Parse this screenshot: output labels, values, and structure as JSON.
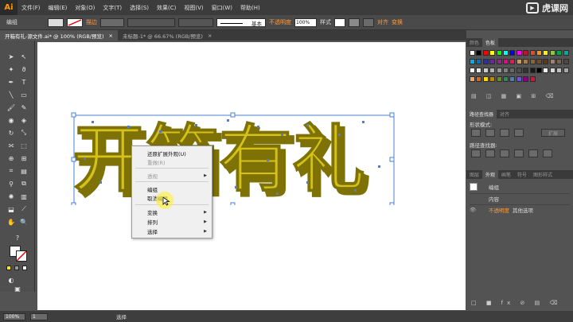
{
  "menubar": {
    "logo": "Ai",
    "items": [
      "文件(F)",
      "编辑(E)",
      "对象(O)",
      "文字(T)",
      "选择(S)",
      "效果(C)",
      "视图(V)",
      "窗口(W)",
      "帮助(H)"
    ],
    "watermark": "虎课网"
  },
  "controlbar": {
    "selection_label": "编组",
    "stroke_label": "描边",
    "stroke_style": "基本",
    "opacity_label": "不透明度",
    "opacity_value": "100%",
    "style_label": "样式",
    "align_label": "对齐",
    "transform_label": "变换"
  },
  "tabs": [
    {
      "label": "开箱有礼-源文件.ai* @ 100% (RGB/预览)",
      "close": "×"
    },
    {
      "label": "未标题-1* @ 66.67% (RGB/预览)",
      "close": "×"
    }
  ],
  "artwork": {
    "text": "开箱有礼",
    "fill_color": "#d4c21a",
    "shadow_color": "#7e7206",
    "selection_color": "#4a7fd4"
  },
  "context_menu": {
    "items": [
      {
        "label": "还原扩展外观(U)",
        "disabled": false
      },
      {
        "label": "重做(R)",
        "disabled": true
      },
      {
        "label": "透视",
        "disabled": true,
        "submenu": true
      },
      {
        "label": "编组",
        "disabled": false
      },
      {
        "label": "取消编组",
        "disabled": false
      },
      {
        "label": "变换",
        "disabled": false,
        "submenu": true
      },
      {
        "label": "排列",
        "disabled": false,
        "submenu": true
      },
      {
        "label": "选择",
        "disabled": false,
        "submenu": true
      }
    ]
  },
  "statusbar": {
    "zoom": "100%",
    "page": "1",
    "tool": "选择"
  },
  "panels": {
    "swatch_tabs": [
      "颜色",
      "色板"
    ],
    "pathfinder_tabs": [
      "路径查找器",
      "对齐"
    ],
    "shape_modes_label": "形状模式:",
    "pathfinder_label": "路径查找器:",
    "expand_label": "扩展",
    "appearance_tabs": [
      "图层",
      "外观",
      "画笔",
      "符号",
      "图形样式"
    ],
    "appearance_title": "编组",
    "appearance_content": "内容",
    "appearance_opacity": "不透明度",
    "appearance_opacity_value": "其他选项"
  },
  "swatch_colors": [
    "#ffffff",
    "#000000",
    "#ff0000",
    "#ffff00",
    "#00ff00",
    "#00ffff",
    "#0000ff",
    "#ff00ff",
    "#c8102e",
    "#e34c26",
    "#f7941d",
    "#fff200",
    "#8dc63f",
    "#00a651",
    "#00a99d",
    "#00aeef",
    "#0072bc",
    "#2e3192",
    "#662d91",
    "#92278f",
    "#ec008c",
    "#ed145b",
    "#c69c6d",
    "#a67c52",
    "#8c6239",
    "#754c24",
    "#603913",
    "#998675",
    "#736357",
    "#534741",
    "#ffffff",
    "#e6e6e6",
    "#cccccc",
    "#b3b3b3",
    "#999999",
    "#808080",
    "#666666",
    "#4d4d4d",
    "#333333",
    "#1a1a1a",
    "#000000",
    "#f2f2f2",
    "#d9d9d9",
    "#bfbfbf",
    "#a6a6a6",
    "#f4a460",
    "#d2691e",
    "#ffd700",
    "#b8860b",
    "#6b8e23",
    "#2e8b57",
    "#4682b4",
    "#6a5acd",
    "#8b008b",
    "#dc143c"
  ]
}
